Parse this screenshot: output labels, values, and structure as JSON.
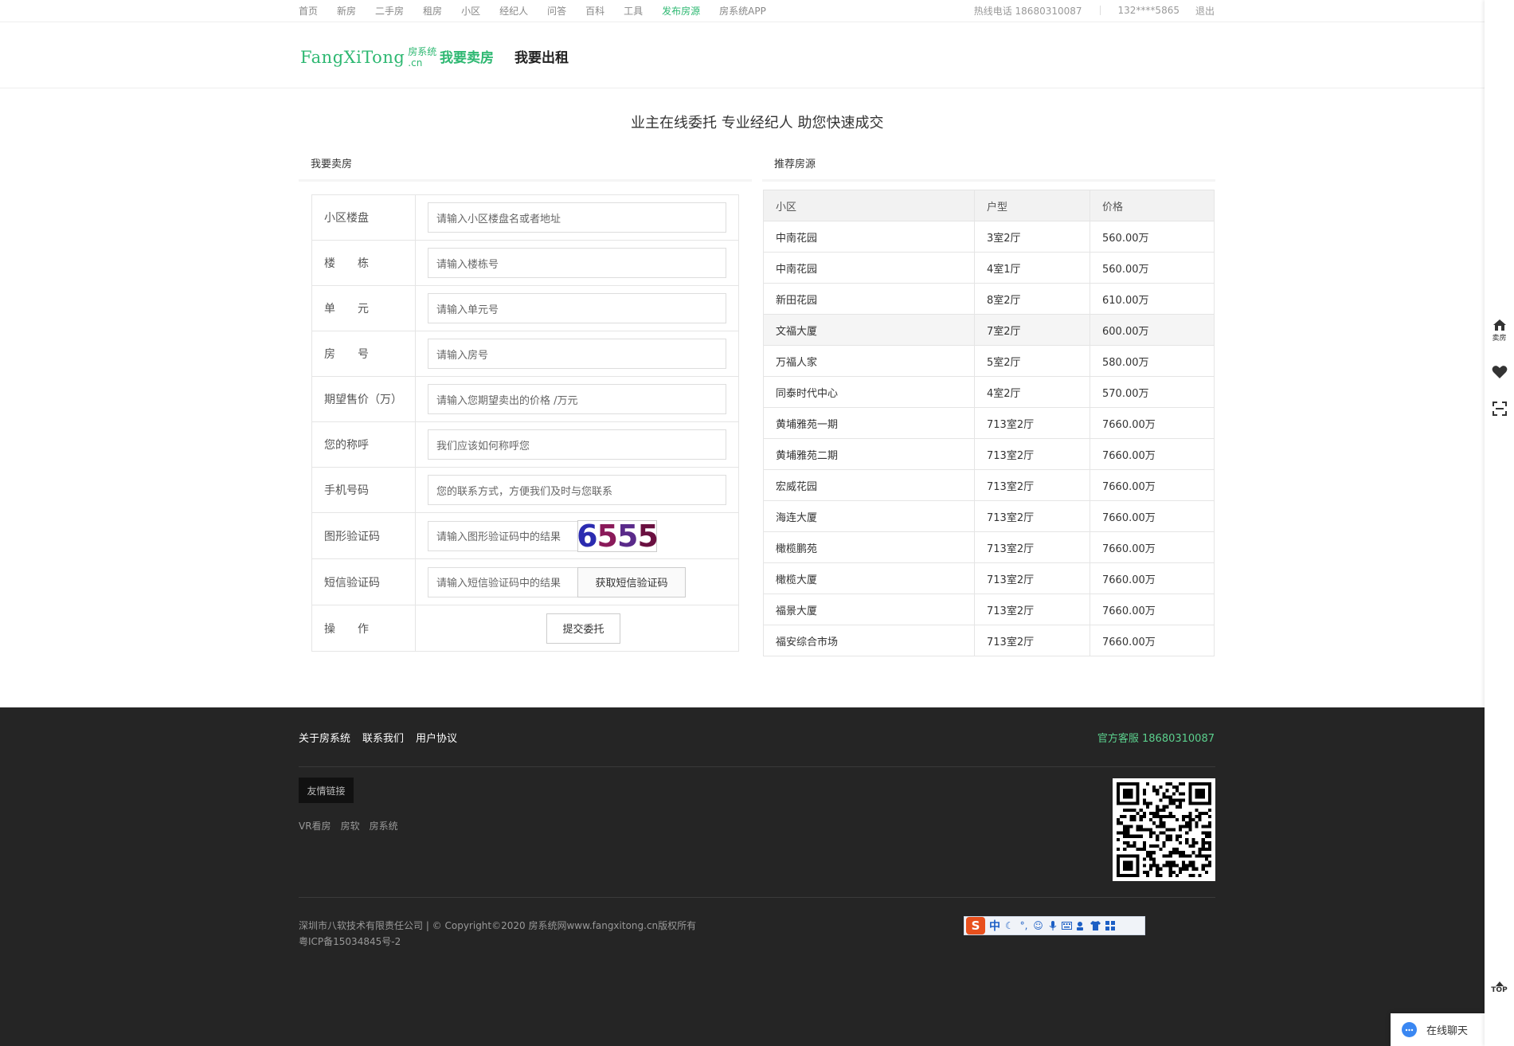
{
  "topnav": {
    "items": [
      "首页",
      "新房",
      "二手房",
      "租房",
      "小区",
      "经纪人",
      "问答",
      "百科",
      "工具",
      "发布房源",
      "房系统APP"
    ],
    "active": "发布房源",
    "hotline": "热线电话 18680310087",
    "user": "132****5865",
    "logout": "退出"
  },
  "header": {
    "logo_main": "FangXiTong",
    "logo_sub_top": "房系统",
    "logo_sub_bottom": ".cn",
    "tab_sell": "我要卖房",
    "tab_rent": "我要出租"
  },
  "slogan": "业主在线委托 专业经纪人 助您快速成交",
  "sell_form": {
    "title": "我要卖房",
    "rows": [
      {
        "label": "小区楼盘",
        "placeholder": "请输入小区楼盘名或者地址"
      },
      {
        "label": "楼　　栋",
        "placeholder": "请输入楼栋号"
      },
      {
        "label": "单　　元",
        "placeholder": "请输入单元号"
      },
      {
        "label": "房　　号",
        "placeholder": "请输入房号"
      },
      {
        "label": "期望售价（万）",
        "placeholder": "请输入您期望卖出的价格 /万元"
      },
      {
        "label": "您的称呼",
        "placeholder": "我们应该如何称呼您"
      },
      {
        "label": "手机号码",
        "placeholder": "您的联系方式，方便我们及时与您联系"
      }
    ],
    "captcha_label": "图形验证码",
    "captcha_placeholder": "请输入图形验证码中的结果",
    "captcha_text": "6555",
    "sms_label": "短信验证码",
    "sms_placeholder": "请输入短信验证码中的结果",
    "sms_button": "获取短信验证码",
    "action_label": "操　　作",
    "submit_button": "提交委托"
  },
  "recommend": {
    "title": "推荐房源",
    "headers": [
      "小区",
      "户型",
      "价格"
    ],
    "rows": [
      [
        "中南花园",
        "3室2厅",
        "560.00万"
      ],
      [
        "中南花园",
        "4室1厅",
        "560.00万"
      ],
      [
        "新田花园",
        "8室2厅",
        "610.00万"
      ],
      [
        "文福大厦",
        "7室2厅",
        "600.00万"
      ],
      [
        "万福人家",
        "5室2厅",
        "580.00万"
      ],
      [
        "同泰时代中心",
        "4室2厅",
        "570.00万"
      ],
      [
        "黄埔雅苑一期",
        "713室2厅",
        "7660.00万"
      ],
      [
        "黄埔雅苑二期",
        "713室2厅",
        "7660.00万"
      ],
      [
        "宏威花园",
        "713室2厅",
        "7660.00万"
      ],
      [
        "海连大厦",
        "713室2厅",
        "7660.00万"
      ],
      [
        "橄榄鹏苑",
        "713室2厅",
        "7660.00万"
      ],
      [
        "橄榄大厦",
        "713室2厅",
        "7660.00万"
      ],
      [
        "福景大厦",
        "713室2厅",
        "7660.00万"
      ],
      [
        "福安综合市场",
        "713室2厅",
        "7660.00万"
      ]
    ]
  },
  "footer": {
    "links": [
      "关于房系统",
      "联系我们",
      "用户协议"
    ],
    "service": "官方客服 18680310087",
    "friend_tag": "友情链接",
    "friend_links": [
      "VR看房",
      "房软",
      "房系统"
    ],
    "copyright_line1": "深圳市八软技术有限责任公司 | © Copyright©2020 房系统网www.fangxitong.cn版权所有",
    "copyright_line2": "粤ICP备15034845号-2"
  },
  "ime": {
    "logo": "S",
    "mode": "中"
  },
  "side": {
    "sell_label": "卖房",
    "top_label": "TOP"
  },
  "chat": {
    "label": "在线聊天"
  },
  "colors": {
    "accent": "#2eb872",
    "footer_bg": "#252525",
    "service": "#5bd08d"
  }
}
